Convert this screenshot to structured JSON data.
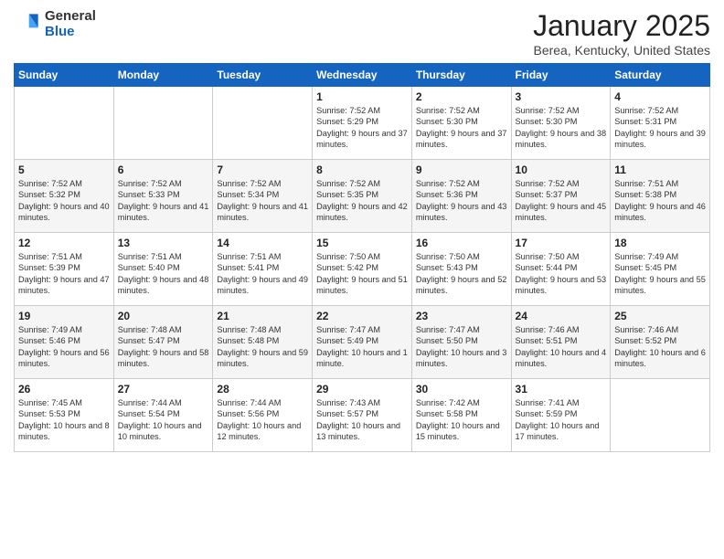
{
  "header": {
    "logo_line1": "General",
    "logo_line2": "Blue",
    "month": "January 2025",
    "location": "Berea, Kentucky, United States"
  },
  "weekdays": [
    "Sunday",
    "Monday",
    "Tuesday",
    "Wednesday",
    "Thursday",
    "Friday",
    "Saturday"
  ],
  "weeks": [
    [
      {
        "day": "",
        "info": ""
      },
      {
        "day": "",
        "info": ""
      },
      {
        "day": "",
        "info": ""
      },
      {
        "day": "1",
        "info": "Sunrise: 7:52 AM\nSunset: 5:29 PM\nDaylight: 9 hours and 37 minutes."
      },
      {
        "day": "2",
        "info": "Sunrise: 7:52 AM\nSunset: 5:30 PM\nDaylight: 9 hours and 37 minutes."
      },
      {
        "day": "3",
        "info": "Sunrise: 7:52 AM\nSunset: 5:30 PM\nDaylight: 9 hours and 38 minutes."
      },
      {
        "day": "4",
        "info": "Sunrise: 7:52 AM\nSunset: 5:31 PM\nDaylight: 9 hours and 39 minutes."
      }
    ],
    [
      {
        "day": "5",
        "info": "Sunrise: 7:52 AM\nSunset: 5:32 PM\nDaylight: 9 hours and 40 minutes."
      },
      {
        "day": "6",
        "info": "Sunrise: 7:52 AM\nSunset: 5:33 PM\nDaylight: 9 hours and 41 minutes."
      },
      {
        "day": "7",
        "info": "Sunrise: 7:52 AM\nSunset: 5:34 PM\nDaylight: 9 hours and 41 minutes."
      },
      {
        "day": "8",
        "info": "Sunrise: 7:52 AM\nSunset: 5:35 PM\nDaylight: 9 hours and 42 minutes."
      },
      {
        "day": "9",
        "info": "Sunrise: 7:52 AM\nSunset: 5:36 PM\nDaylight: 9 hours and 43 minutes."
      },
      {
        "day": "10",
        "info": "Sunrise: 7:52 AM\nSunset: 5:37 PM\nDaylight: 9 hours and 45 minutes."
      },
      {
        "day": "11",
        "info": "Sunrise: 7:51 AM\nSunset: 5:38 PM\nDaylight: 9 hours and 46 minutes."
      }
    ],
    [
      {
        "day": "12",
        "info": "Sunrise: 7:51 AM\nSunset: 5:39 PM\nDaylight: 9 hours and 47 minutes."
      },
      {
        "day": "13",
        "info": "Sunrise: 7:51 AM\nSunset: 5:40 PM\nDaylight: 9 hours and 48 minutes."
      },
      {
        "day": "14",
        "info": "Sunrise: 7:51 AM\nSunset: 5:41 PM\nDaylight: 9 hours and 49 minutes."
      },
      {
        "day": "15",
        "info": "Sunrise: 7:50 AM\nSunset: 5:42 PM\nDaylight: 9 hours and 51 minutes."
      },
      {
        "day": "16",
        "info": "Sunrise: 7:50 AM\nSunset: 5:43 PM\nDaylight: 9 hours and 52 minutes."
      },
      {
        "day": "17",
        "info": "Sunrise: 7:50 AM\nSunset: 5:44 PM\nDaylight: 9 hours and 53 minutes."
      },
      {
        "day": "18",
        "info": "Sunrise: 7:49 AM\nSunset: 5:45 PM\nDaylight: 9 hours and 55 minutes."
      }
    ],
    [
      {
        "day": "19",
        "info": "Sunrise: 7:49 AM\nSunset: 5:46 PM\nDaylight: 9 hours and 56 minutes."
      },
      {
        "day": "20",
        "info": "Sunrise: 7:48 AM\nSunset: 5:47 PM\nDaylight: 9 hours and 58 minutes."
      },
      {
        "day": "21",
        "info": "Sunrise: 7:48 AM\nSunset: 5:48 PM\nDaylight: 9 hours and 59 minutes."
      },
      {
        "day": "22",
        "info": "Sunrise: 7:47 AM\nSunset: 5:49 PM\nDaylight: 10 hours and 1 minute."
      },
      {
        "day": "23",
        "info": "Sunrise: 7:47 AM\nSunset: 5:50 PM\nDaylight: 10 hours and 3 minutes."
      },
      {
        "day": "24",
        "info": "Sunrise: 7:46 AM\nSunset: 5:51 PM\nDaylight: 10 hours and 4 minutes."
      },
      {
        "day": "25",
        "info": "Sunrise: 7:46 AM\nSunset: 5:52 PM\nDaylight: 10 hours and 6 minutes."
      }
    ],
    [
      {
        "day": "26",
        "info": "Sunrise: 7:45 AM\nSunset: 5:53 PM\nDaylight: 10 hours and 8 minutes."
      },
      {
        "day": "27",
        "info": "Sunrise: 7:44 AM\nSunset: 5:54 PM\nDaylight: 10 hours and 10 minutes."
      },
      {
        "day": "28",
        "info": "Sunrise: 7:44 AM\nSunset: 5:56 PM\nDaylight: 10 hours and 12 minutes."
      },
      {
        "day": "29",
        "info": "Sunrise: 7:43 AM\nSunset: 5:57 PM\nDaylight: 10 hours and 13 minutes."
      },
      {
        "day": "30",
        "info": "Sunrise: 7:42 AM\nSunset: 5:58 PM\nDaylight: 10 hours and 15 minutes."
      },
      {
        "day": "31",
        "info": "Sunrise: 7:41 AM\nSunset: 5:59 PM\nDaylight: 10 hours and 17 minutes."
      },
      {
        "day": "",
        "info": ""
      }
    ]
  ]
}
